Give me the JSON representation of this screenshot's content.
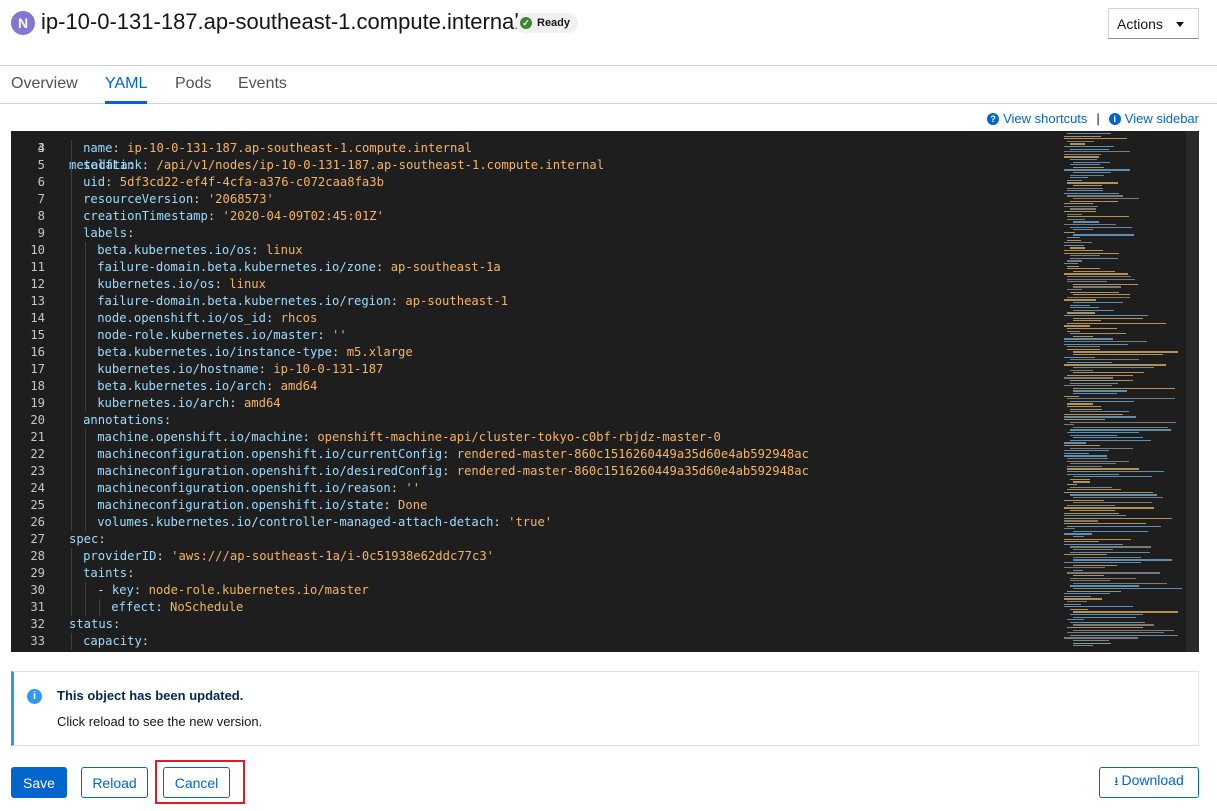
{
  "header": {
    "badge": "N",
    "title": "ip-10-0-131-187.ap-southeast-1.compute.internal",
    "status": "Ready",
    "actions_label": "Actions"
  },
  "tabs": [
    {
      "label": "Overview",
      "active": false
    },
    {
      "label": "YAML",
      "active": true
    },
    {
      "label": "Pods",
      "active": false
    },
    {
      "label": "Events",
      "active": false
    }
  ],
  "links": {
    "shortcuts": "View shortcuts",
    "separator": "|",
    "sidebar": "View sidebar"
  },
  "editor": {
    "first_line_partial": "metadata:",
    "lines": [
      {
        "n": "4",
        "indent": 1,
        "key": "name",
        "value": "ip-10-0-131-187.ap-southeast-1.compute.internal"
      },
      {
        "n": "5",
        "indent": 1,
        "key": "selfLink",
        "value": "/api/v1/nodes/ip-10-0-131-187.ap-southeast-1.compute.internal"
      },
      {
        "n": "6",
        "indent": 1,
        "key": "uid",
        "value": "5df3cd22-ef4f-4cfa-a376-c072caa8fa3b"
      },
      {
        "n": "7",
        "indent": 1,
        "key": "resourceVersion",
        "value": "'2068573'"
      },
      {
        "n": "8",
        "indent": 1,
        "key": "creationTimestamp",
        "value": "'2020-04-09T02:45:01Z'"
      },
      {
        "n": "9",
        "indent": 1,
        "key": "labels",
        "value": ""
      },
      {
        "n": "10",
        "indent": 2,
        "key": "beta.kubernetes.io/os",
        "value": "linux"
      },
      {
        "n": "11",
        "indent": 2,
        "key": "failure-domain.beta.kubernetes.io/zone",
        "value": "ap-southeast-1a"
      },
      {
        "n": "12",
        "indent": 2,
        "key": "kubernetes.io/os",
        "value": "linux"
      },
      {
        "n": "13",
        "indent": 2,
        "key": "failure-domain.beta.kubernetes.io/region",
        "value": "ap-southeast-1"
      },
      {
        "n": "14",
        "indent": 2,
        "key": "node.openshift.io/os_id",
        "value": "rhcos"
      },
      {
        "n": "15",
        "indent": 2,
        "key": "node-role.kubernetes.io/master",
        "value": "''"
      },
      {
        "n": "16",
        "indent": 2,
        "key": "beta.kubernetes.io/instance-type",
        "value": "m5.xlarge"
      },
      {
        "n": "17",
        "indent": 2,
        "key": "kubernetes.io/hostname",
        "value": "ip-10-0-131-187"
      },
      {
        "n": "18",
        "indent": 2,
        "key": "beta.kubernetes.io/arch",
        "value": "amd64"
      },
      {
        "n": "19",
        "indent": 2,
        "key": "kubernetes.io/arch",
        "value": "amd64"
      },
      {
        "n": "20",
        "indent": 1,
        "key": "annotations",
        "value": ""
      },
      {
        "n": "21",
        "indent": 2,
        "key": "machine.openshift.io/machine",
        "value": "openshift-machine-api/cluster-tokyo-c0bf-rbjdz-master-0"
      },
      {
        "n": "22",
        "indent": 2,
        "key": "machineconfiguration.openshift.io/currentConfig",
        "value": "rendered-master-860c1516260449a35d60e4ab592948ac"
      },
      {
        "n": "23",
        "indent": 2,
        "key": "machineconfiguration.openshift.io/desiredConfig",
        "value": "rendered-master-860c1516260449a35d60e4ab592948ac"
      },
      {
        "n": "24",
        "indent": 2,
        "key": "machineconfiguration.openshift.io/reason",
        "value": "''"
      },
      {
        "n": "25",
        "indent": 2,
        "key": "machineconfiguration.openshift.io/state",
        "value": "Done"
      },
      {
        "n": "26",
        "indent": 2,
        "key": "volumes.kubernetes.io/controller-managed-attach-detach",
        "value": "'true'"
      },
      {
        "n": "27",
        "indent": 0,
        "key": "spec",
        "value": ""
      },
      {
        "n": "28",
        "indent": 1,
        "key": "providerID",
        "value": "'aws:///ap-southeast-1a/i-0c51938e62ddc77c3'"
      },
      {
        "n": "29",
        "indent": 1,
        "key": "taints",
        "value": ""
      },
      {
        "n": "30",
        "indent": 2,
        "dash": true,
        "key": "key",
        "value": "node-role.kubernetes.io/master"
      },
      {
        "n": "31",
        "indent": 3,
        "key": "effect",
        "value": "NoSchedule"
      },
      {
        "n": "32",
        "indent": 0,
        "key": "status",
        "value": ""
      },
      {
        "n": "33",
        "indent": 1,
        "key": "capacity",
        "value": ""
      }
    ]
  },
  "alert": {
    "title": "This object has been updated.",
    "body": "Click reload to see the new version."
  },
  "buttons": {
    "save": "Save",
    "reload": "Reload",
    "cancel": "Cancel",
    "download": "Download"
  },
  "colors": {
    "primary": "#0066cc",
    "editor_bg": "#1e1e1e",
    "yaml_key": "#9cdcfe",
    "yaml_value": "#f4b464",
    "status_ok": "#3e8635",
    "highlight": "#e01b24"
  }
}
